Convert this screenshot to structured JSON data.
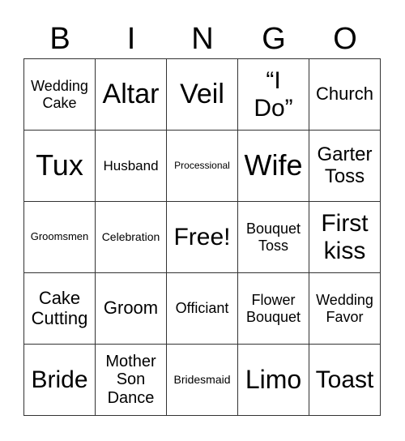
{
  "header": [
    "B",
    "I",
    "N",
    "G",
    "O"
  ],
  "cells": [
    "Wedding Cake",
    "Altar",
    "Veil",
    "“I Do”",
    "Church",
    "Tux",
    "Husband",
    "Processional",
    "Wife",
    "Garter Toss",
    "Groomsmen",
    "Celebration",
    "Free!",
    "Bouquet Toss",
    "First kiss",
    "Cake Cutting",
    "Groom",
    "Officiant",
    "Flower Bouquet",
    "Wedding Favor",
    "Bride",
    "Mother Son Dance",
    "Bridesmaid",
    "Limo",
    "Toast"
  ]
}
